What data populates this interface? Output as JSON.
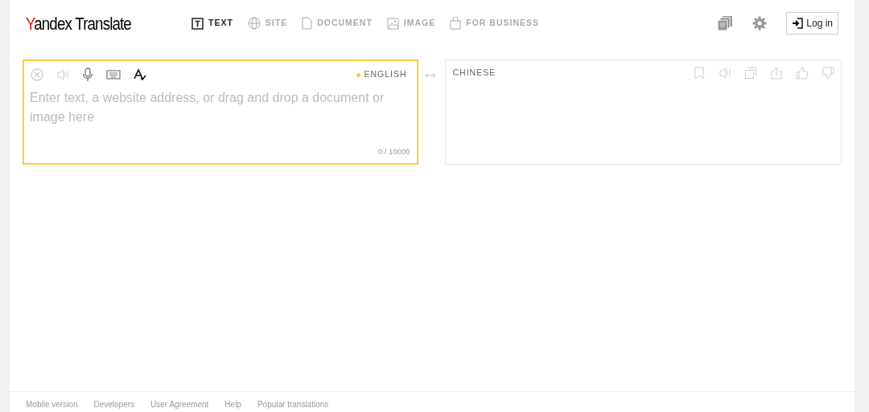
{
  "logo": {
    "first_letter": "Y",
    "rest": "andex",
    "product": "Translate"
  },
  "tabs": [
    {
      "label": "TEXT",
      "selected": true
    },
    {
      "label": "SITE",
      "selected": false
    },
    {
      "label": "DOCUMENT",
      "selected": false
    },
    {
      "label": "IMAGE",
      "selected": false
    },
    {
      "label": "FOR BUSINESS",
      "selected": false
    }
  ],
  "login_button": "Log in",
  "source": {
    "language": "ENGLISH",
    "detected": true,
    "placeholder": "Enter text, a website address, or drag and drop a document or image here",
    "counter": "0 / 10000"
  },
  "target": {
    "language": "CHINESE"
  },
  "footer_links": [
    "Mobile version",
    "Developers",
    "User Agreement",
    "Help",
    "Popular translations"
  ]
}
